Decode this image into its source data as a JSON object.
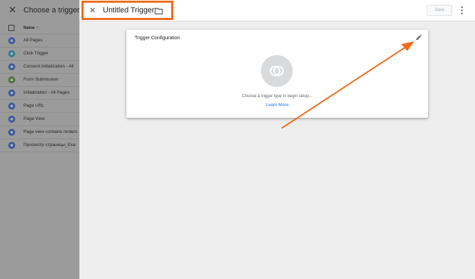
{
  "picker": {
    "title": "Choose a trigger",
    "column_header": "Name",
    "sort_indicator": "↑",
    "items": [
      {
        "label": "All Pages",
        "icon": "pageview-icon",
        "color": "#3d6fd6"
      },
      {
        "label": "Click Trigger",
        "icon": "click-icon",
        "color": "#29a3c6"
      },
      {
        "label": "Consent Initialization - All",
        "icon": "consent-icon",
        "color": "#3d6fd6"
      },
      {
        "label": "Form Submission",
        "icon": "form-icon",
        "color": "#4d9a3a"
      },
      {
        "label": "Initialization - All Pages",
        "icon": "init-icon",
        "color": "#3d6fd6"
      },
      {
        "label": "Page URL",
        "icon": "pageview-icon",
        "color": "#3d6fd6"
      },
      {
        "label": "Page View",
        "icon": "pageview-icon",
        "color": "#3d6fd6"
      },
      {
        "label": "Page view contains /orders",
        "icon": "pageview-icon",
        "color": "#3d6fd6"
      },
      {
        "label": "Просмотр страницы_Exa",
        "icon": "pageview-icon",
        "color": "#3d6fd6"
      }
    ]
  },
  "editor": {
    "title": "Untitled Trigger",
    "save_label": "Save"
  },
  "card": {
    "title": "Trigger Configuration",
    "hint": "Choose a trigger type to begin setup...",
    "link": "Learn More"
  },
  "colors": {
    "highlight": "#ef6c1a",
    "link": "#1a73e8"
  }
}
